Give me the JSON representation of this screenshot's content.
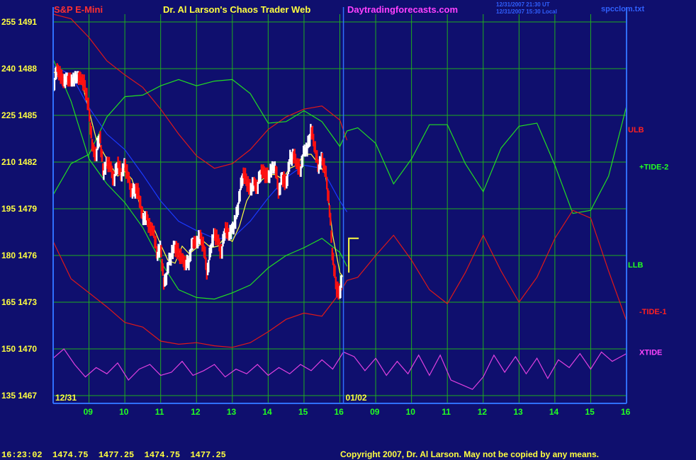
{
  "header": {
    "instrument": "S&P E-Mini",
    "site_title": "Dr. Al Larson's Chaos Trader Web",
    "site_url": "Daytradingforecasts.com",
    "timestamp_line1": "12/31/2007 21:30 UT",
    "timestamp_line2": "12/31/2007 15:30 Local",
    "file_name": "spcclom.txt"
  },
  "footer": {
    "quote": "16:23:02  1474.75  1477.25  1474.75  1477.25",
    "copyright": "Copyright 2007, Dr. Al Larson. May not be copied by any means."
  },
  "colors": {
    "background": "#0f0f6e",
    "grid": "#1fae1f",
    "axis": "#2f6fff",
    "price_up": "#ffffff",
    "price_down": "#ff1010",
    "avg": "#ffff40",
    "ulb": "#e01818",
    "tide2": "#22dd22",
    "llb": "#22dd22",
    "tide1": "#e01818",
    "xtide": "#e040e0",
    "blue_avg": "#1a3aff",
    "label_ulb": "#ff2020",
    "label_green": "#22ff22",
    "label_xtide": "#ff44ff"
  },
  "chart_data": {
    "type": "line",
    "title": "",
    "y_left_labels": [
      "255 1491",
      "240 1488",
      "225 1485",
      "210 1482",
      "195 1479",
      "180 1476",
      "165 1473",
      "150 1470",
      "135 1467"
    ],
    "y_left_values": [
      255,
      240,
      225,
      210,
      195,
      180,
      165,
      150,
      135
    ],
    "y_right_values": [
      1491,
      1488,
      1485,
      1482,
      1479,
      1476,
      1473,
      1470,
      1467
    ],
    "ylim_price": [
      1466.5,
      1491.5
    ],
    "x_tick_labels": [
      "09",
      "10",
      "11",
      "12",
      "13",
      "14",
      "15",
      "16",
      "09",
      "10",
      "11",
      "12",
      "13",
      "14",
      "15",
      "16"
    ],
    "session_labels": [
      {
        "text": "12/31",
        "day": 0
      },
      {
        "text": "01/02",
        "day": 1
      }
    ],
    "series_labels": [
      {
        "text": "ULB",
        "color_key": "label_ulb",
        "price": 1484.1
      },
      {
        "text": "+TIDE-2",
        "color_key": "label_green",
        "price": 1481.7
      },
      {
        "text": "LLB",
        "color_key": "label_green",
        "price": 1475.4
      },
      {
        "text": "-TIDE-1",
        "color_key": "label_red",
        "price": 1472.4
      },
      {
        "text": "XTIDE",
        "color_key": "label_xtide",
        "price": 1469.8
      }
    ],
    "series": [
      {
        "id": "ulb",
        "color_key": "ulb",
        "x": [
          8.0,
          8.5,
          9.0,
          9.5,
          10.0,
          10.5,
          11.0,
          11.5,
          12.0,
          12.5,
          13.0,
          13.5,
          14.0,
          14.5,
          15.0,
          15.5,
          16.0,
          16.2
        ],
        "values": [
          1491.5,
          1491.2,
          1490.0,
          1488.5,
          1487.6,
          1486.8,
          1485.4,
          1483.8,
          1482.4,
          1481.6,
          1481.9,
          1482.8,
          1484.1,
          1484.9,
          1485.4,
          1485.6,
          1484.7,
          1483.4
        ]
      },
      {
        "id": "tide2",
        "color_key": "tide2",
        "x": [
          8.0,
          8.5,
          9.0,
          9.5,
          10.0,
          10.5,
          11.0,
          11.5,
          12.0,
          12.5,
          13.0,
          13.5,
          14.0,
          14.5,
          15.0,
          15.5,
          16.0,
          16.2,
          16.5,
          17.0,
          17.5,
          18.0,
          18.5,
          19.0,
          19.5,
          20.0,
          20.5,
          21.0,
          21.5,
          22.0,
          22.5,
          23.0,
          23.5,
          24.0
        ],
        "values": [
          1479.9,
          1481.9,
          1482.5,
          1484.9,
          1486.2,
          1486.3,
          1486.9,
          1487.3,
          1486.9,
          1487.2,
          1487.3,
          1486.4,
          1484.5,
          1484.6,
          1485.3,
          1484.6,
          1483.0,
          1484.0,
          1484.2,
          1483.2,
          1480.6,
          1482.2,
          1484.4,
          1484.4,
          1481.9,
          1480.1,
          1482.9,
          1484.3,
          1484.5,
          1481.8,
          1478.7,
          1478.9,
          1481.1,
          1485.6
        ]
      },
      {
        "id": "blue",
        "color_key": "blue_avg",
        "x": [
          8.0,
          8.5,
          9.0,
          9.5,
          10.0,
          10.5,
          11.0,
          11.5,
          12.0,
          12.5,
          13.0,
          13.5,
          14.0,
          14.5,
          15.0,
          15.5,
          16.0,
          16.2
        ],
        "values": [
          1488.2,
          1487.6,
          1485.5,
          1483.8,
          1482.8,
          1481.2,
          1479.5,
          1478.2,
          1477.6,
          1477.1,
          1477.1,
          1478.2,
          1479.7,
          1481.0,
          1481.8,
          1481.6,
          1479.5,
          1478.8
        ]
      },
      {
        "id": "llb",
        "color_key": "llb",
        "x": [
          8.0,
          8.5,
          9.0,
          9.5,
          10.0,
          10.5,
          11.0,
          11.5,
          12.0,
          12.5,
          13.0,
          13.5,
          14.0,
          14.5,
          15.0,
          15.5,
          16.0,
          16.2
        ],
        "values": [
          1488.6,
          1485.9,
          1482.2,
          1480.6,
          1479.4,
          1477.8,
          1475.6,
          1473.8,
          1473.3,
          1473.2,
          1473.6,
          1474.1,
          1475.2,
          1476.0,
          1476.5,
          1477.1,
          1476.2,
          1475.3
        ]
      },
      {
        "id": "tide1",
        "color_key": "tide1",
        "x": [
          8.0,
          8.5,
          9.0,
          9.5,
          10.0,
          10.5,
          11.0,
          11.5,
          12.0,
          12.5,
          13.0,
          13.5,
          14.0,
          14.5,
          15.0,
          15.5,
          16.0,
          16.2,
          16.5,
          17.0,
          17.5,
          18.0,
          18.5,
          19.0,
          19.5,
          20.0,
          20.5,
          21.0,
          21.5,
          22.0,
          22.5,
          23.0,
          23.5,
          24.0
        ],
        "values": [
          1476.9,
          1474.5,
          1473.6,
          1472.7,
          1471.7,
          1471.4,
          1470.5,
          1470.3,
          1470.4,
          1470.2,
          1470.1,
          1470.4,
          1471.1,
          1471.9,
          1472.3,
          1472.1,
          1473.6,
          1474.4,
          1474.6,
          1476.0,
          1477.3,
          1475.7,
          1473.8,
          1472.9,
          1474.9,
          1477.3,
          1475.0,
          1473.0,
          1474.6,
          1477.1,
          1478.9,
          1478.4,
          1475.0,
          1471.8
        ]
      },
      {
        "id": "xtide",
        "color_key": "xtide",
        "x": [
          8.0,
          8.3,
          8.6,
          8.9,
          9.2,
          9.5,
          9.8,
          10.1,
          10.4,
          10.7,
          11.0,
          11.3,
          11.6,
          11.9,
          12.2,
          12.5,
          12.8,
          13.1,
          13.4,
          13.7,
          14.0,
          14.3,
          14.6,
          14.9,
          15.2,
          15.5,
          15.8,
          16.1,
          16.4,
          16.7,
          17.0,
          17.3,
          17.6,
          17.9,
          18.2,
          18.5,
          18.8,
          19.1,
          19.4,
          19.7,
          20.0,
          20.3,
          20.6,
          20.9,
          21.2,
          21.5,
          21.8,
          22.1,
          22.4,
          22.7,
          23.0,
          23.3,
          23.6,
          24.0
        ],
        "values": [
          1469.4,
          1470.0,
          1469.0,
          1468.2,
          1468.8,
          1468.4,
          1469.1,
          1468.0,
          1468.7,
          1469.0,
          1468.3,
          1468.5,
          1469.2,
          1468.3,
          1468.6,
          1469.0,
          1468.2,
          1468.7,
          1468.4,
          1469.0,
          1468.3,
          1468.8,
          1468.4,
          1469.0,
          1468.6,
          1469.3,
          1468.7,
          1469.8,
          1469.5,
          1468.6,
          1469.4,
          1468.3,
          1469.2,
          1468.4,
          1469.6,
          1468.3,
          1469.6,
          1468.0,
          1467.7,
          1467.4,
          1468.2,
          1469.6,
          1468.5,
          1469.5,
          1468.4,
          1469.4,
          1468.1,
          1469.3,
          1468.8,
          1469.7,
          1468.7,
          1469.8,
          1469.2,
          1469.7
        ]
      },
      {
        "id": "price_avg",
        "color_key": "avg",
        "x": [
          8.0,
          8.2,
          8.4,
          8.6,
          8.8,
          9.0,
          9.2,
          9.4,
          9.6,
          9.8,
          10.0,
          10.2,
          10.4,
          10.6,
          10.8,
          11.0,
          11.2,
          11.4,
          11.6,
          11.8,
          12.0,
          12.2,
          12.4,
          12.6,
          12.8,
          13.0,
          13.2,
          13.4,
          13.6,
          13.8,
          14.0,
          14.2,
          14.4,
          14.6,
          14.8,
          15.0,
          15.2,
          15.4,
          15.6,
          15.8,
          16.0,
          16.1
        ],
        "values": [
          1487.8,
          1487.5,
          1487.4,
          1487.3,
          1487.1,
          1485.3,
          1483.5,
          1482.6,
          1481.8,
          1481.1,
          1481.4,
          1480.9,
          1479.4,
          1478.5,
          1477.8,
          1476.7,
          1475.7,
          1475.5,
          1476.6,
          1476.1,
          1476.5,
          1476.9,
          1476.5,
          1476.6,
          1477.2,
          1476.9,
          1477.9,
          1479.5,
          1480.3,
          1480.8,
          1481.2,
          1481.2,
          1480.9,
          1481.6,
          1481.8,
          1482.5,
          1482.5,
          1481.9,
          1481.2,
          1477.3,
          1474.9,
          1474.6
        ]
      },
      {
        "id": "price",
        "x": [
          8.0,
          8.1,
          8.2,
          8.3,
          8.4,
          8.5,
          8.6,
          8.7,
          8.8,
          8.9,
          9.0,
          9.1,
          9.2,
          9.3,
          9.4,
          9.5,
          9.6,
          9.7,
          9.8,
          9.9,
          10.0,
          10.1,
          10.2,
          10.3,
          10.4,
          10.5,
          10.6,
          10.7,
          10.8,
          10.9,
          11.0,
          11.1,
          11.2,
          11.3,
          11.4,
          11.5,
          11.6,
          11.7,
          11.8,
          11.9,
          12.0,
          12.1,
          12.2,
          12.3,
          12.4,
          12.5,
          12.6,
          12.7,
          12.8,
          12.9,
          13.0,
          13.1,
          13.2,
          13.3,
          13.4,
          13.5,
          13.6,
          13.7,
          13.8,
          13.9,
          14.0,
          14.1,
          14.2,
          14.3,
          14.4,
          14.5,
          14.6,
          14.7,
          14.8,
          14.9,
          15.0,
          15.1,
          15.2,
          15.3,
          15.4,
          15.5,
          15.6,
          15.7,
          15.8,
          15.9,
          16.0,
          16.05
        ],
        "values": [
          1486.8,
          1488.0,
          1487.6,
          1487.1,
          1487.4,
          1487.2,
          1487.4,
          1487.5,
          1487.3,
          1486.8,
          1485.3,
          1482.9,
          1482.4,
          1483.8,
          1481.2,
          1482.0,
          1481.7,
          1480.8,
          1482.0,
          1481.1,
          1481.9,
          1481.0,
          1480.0,
          1480.3,
          1479.9,
          1478.3,
          1478.5,
          1477.8,
          1477.6,
          1476.0,
          1476.6,
          1474.0,
          1475.2,
          1476.1,
          1476.6,
          1476.1,
          1475.8,
          1475.4,
          1475.7,
          1476.9,
          1476.8,
          1477.3,
          1476.6,
          1474.8,
          1476.5,
          1477.4,
          1477.0,
          1476.1,
          1477.8,
          1477.3,
          1477.7,
          1478.3,
          1479.8,
          1481.3,
          1480.8,
          1480.2,
          1480.7,
          1480.3,
          1481.5,
          1481.3,
          1481.0,
          1481.6,
          1481.7,
          1480.0,
          1481.1,
          1480.5,
          1482.1,
          1482.5,
          1481.9,
          1481.4,
          1482.7,
          1482.9,
          1484.1,
          1483.0,
          1481.6,
          1482.3,
          1481.4,
          1479.4,
          1475.9,
          1474.0,
          1473.5,
          1474.6
        ]
      }
    ],
    "projection_bracket": {
      "x": 16.25,
      "y_low": 1474.9,
      "y_high": 1477.1
    }
  }
}
